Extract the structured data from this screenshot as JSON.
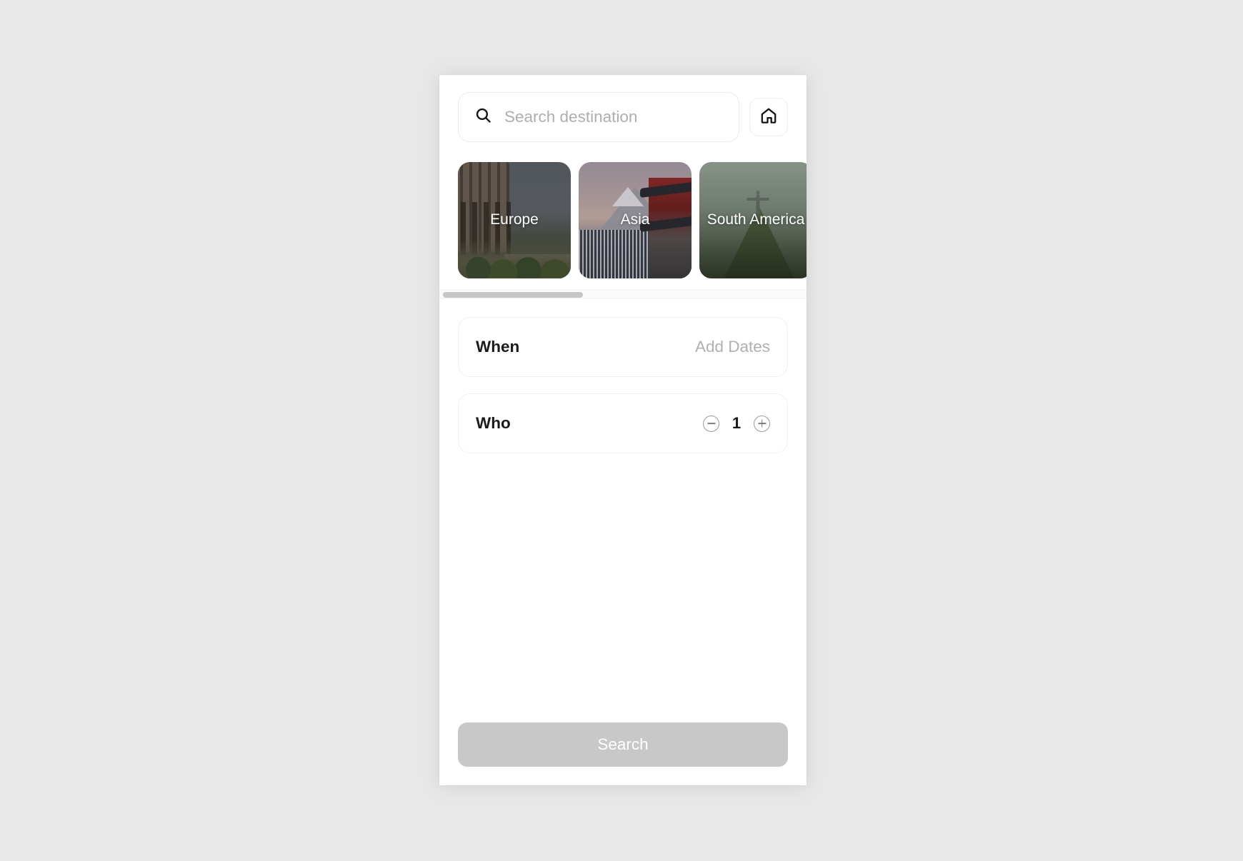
{
  "search": {
    "icon": "search-icon",
    "placeholder": "Search destination",
    "value": ""
  },
  "home_button": {
    "icon": "home-icon",
    "label": ""
  },
  "destinations": {
    "icon": "chevron-right-icon",
    "items": [
      {
        "label": "Europe",
        "photo": "colosseum-rome"
      },
      {
        "label": "Asia",
        "photo": "mount-fuji-pagoda"
      },
      {
        "label": "South America",
        "photo": "christ-the-redeemer-rio"
      }
    ]
  },
  "options": {
    "when": {
      "label": "When",
      "value": "Add Dates"
    },
    "who": {
      "label": "Who",
      "count": "1",
      "decrement_icon": "minus-circle-icon",
      "increment_icon": "plus-circle-icon"
    }
  },
  "footer": {
    "search_label": "Search"
  },
  "colors": {
    "page_background": "#e8e8e8",
    "panel_background": "#ffffff",
    "text_primary": "#1b1b1b",
    "text_muted": "#b0b0b0",
    "placeholder": "#aeaeae",
    "card_border": "#efefef",
    "button_disabled": "#c8c8c8",
    "button_text": "#ffffff",
    "scrollbar_thumb": "#c6c6c6",
    "scrollbar_track": "#fafafa"
  }
}
